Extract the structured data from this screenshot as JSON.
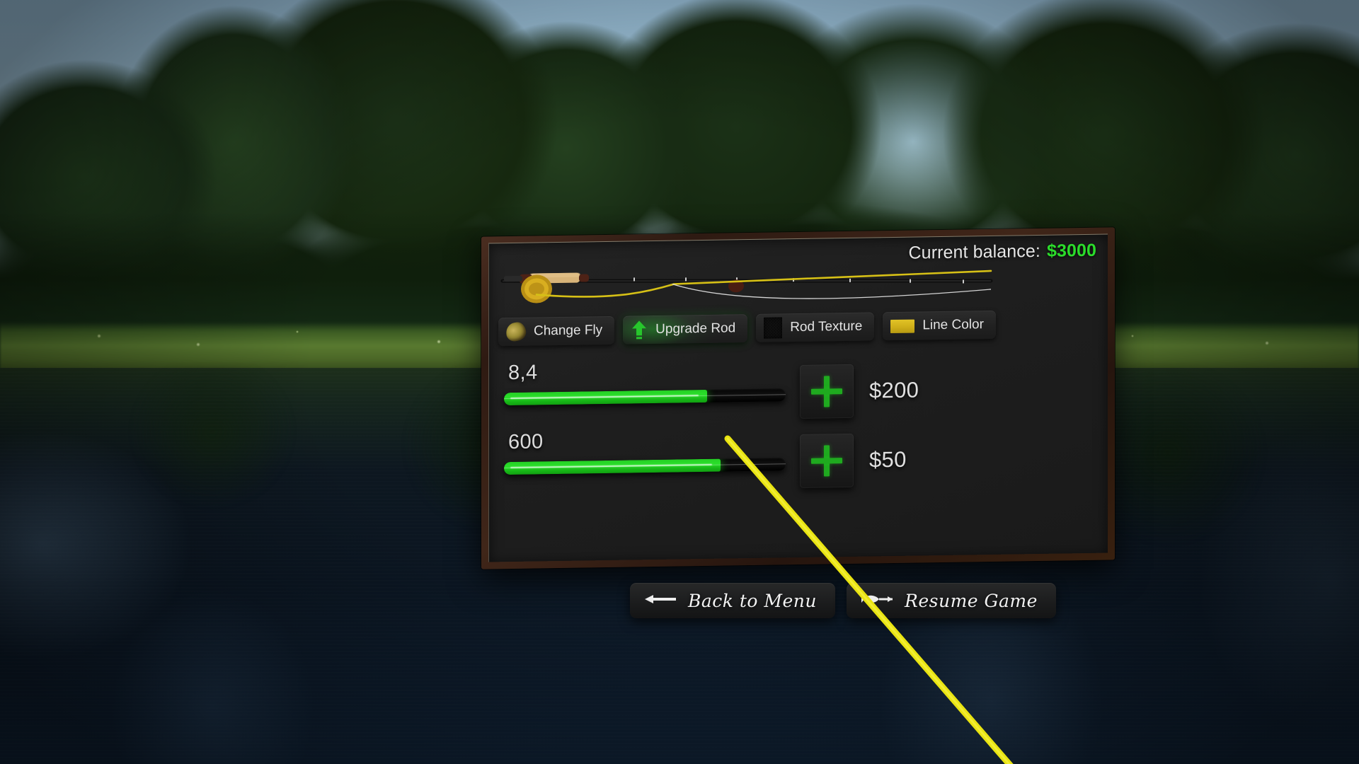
{
  "scene": {
    "description": "Fly fishing game paused over a forest lake at dusk",
    "sky_color": "#a9ccdf",
    "foliage_color": "#1b3117",
    "water_color": "#0b1622",
    "fishing_line_color": "#e9e410"
  },
  "panel": {
    "balance_label": "Current balance:",
    "balance_value": "$3000",
    "balance_color": "#2bdc2b",
    "frame_color": "#3a2216",
    "body_color": "#1e1e1e",
    "rod_preview": {
      "name": "fly-rod",
      "handle_color": "#d8b479",
      "reel_color": "#d4a81a",
      "blank_color": "#121212",
      "line_color": "#d6c016"
    },
    "options": [
      {
        "label": "Change Fly",
        "icon": "fly-swatch-icon",
        "swatch_class": "fly",
        "active": false
      },
      {
        "label": "Upgrade Rod",
        "icon": "upgrade-arrow-icon",
        "swatch_class": "up",
        "active": true
      },
      {
        "label": "Rod Texture",
        "icon": "rod-texture-swatch-icon",
        "swatch_class": "tex",
        "active": false
      },
      {
        "label": "Line Color",
        "icon": "line-color-swatch-icon",
        "swatch_class": "col",
        "active": false
      }
    ],
    "stats": [
      {
        "name": "rod-length",
        "value": "8,4",
        "fill_percent": 72,
        "price": "$200",
        "add_icon": "plus-icon"
      },
      {
        "name": "line-length",
        "value": "600",
        "fill_percent": 77,
        "price": "$50",
        "add_icon": "plus-icon"
      }
    ],
    "fill_color": "#22d822",
    "track_color": "#070707"
  },
  "bottom_nav": [
    {
      "label": "Back to Menu",
      "icon": "left-arrow-icon"
    },
    {
      "label": "Resume Game",
      "icon": "fish-icon"
    }
  ]
}
